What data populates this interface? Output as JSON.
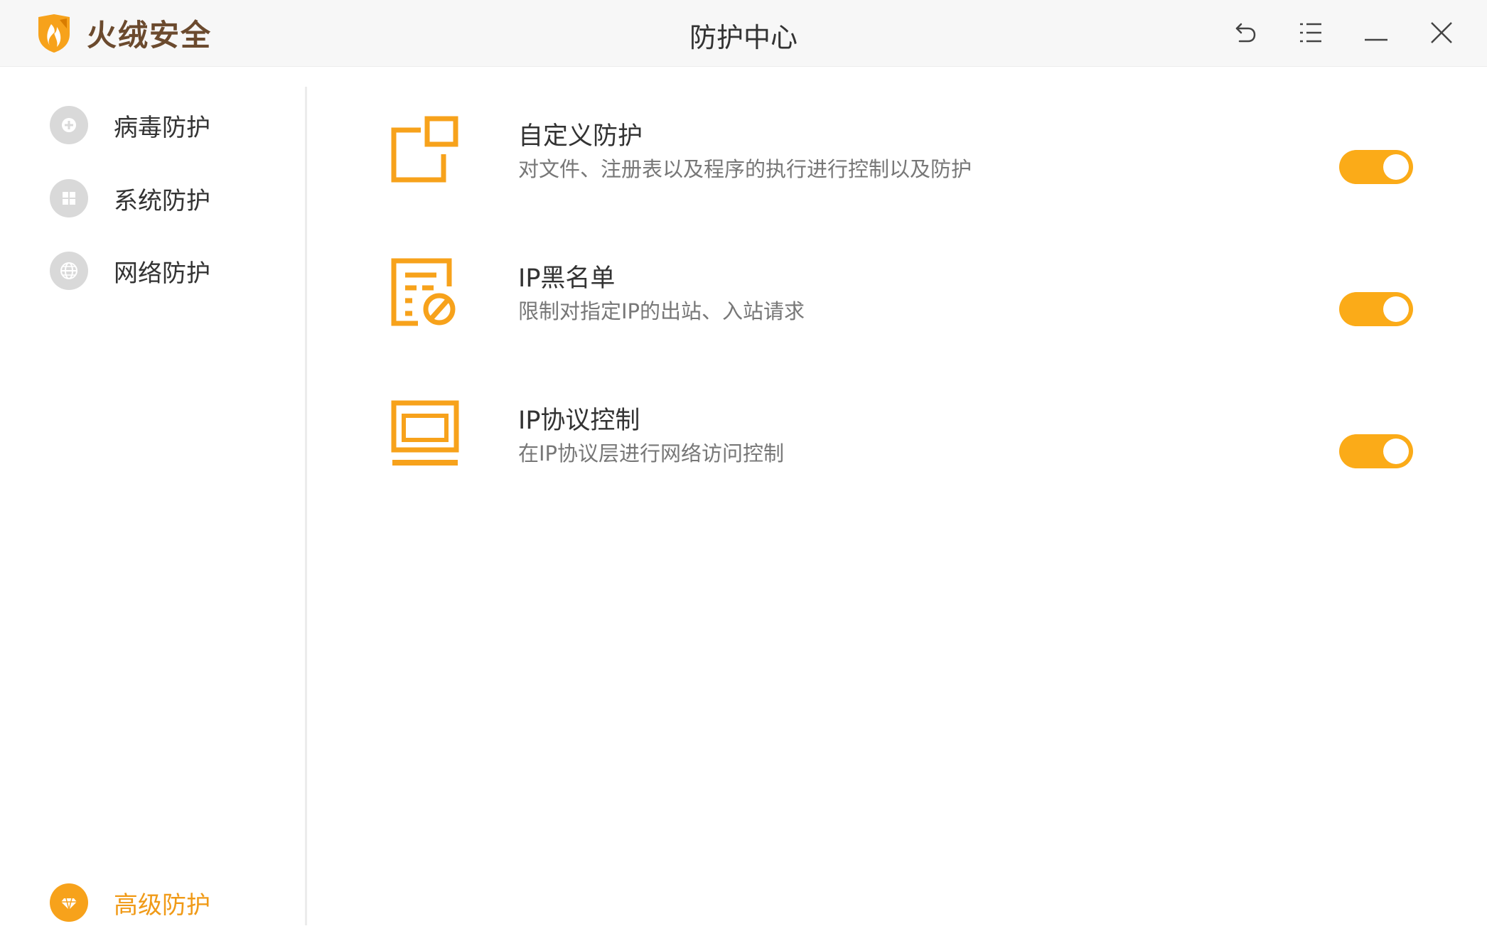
{
  "app": {
    "brand_name": "火绒安全",
    "window_title": "防护中心",
    "accent_color": "#f7a21b",
    "brand_text_color": "#6b4a2e",
    "controls": [
      {
        "name": "back",
        "icon": "undo-arrow-icon"
      },
      {
        "name": "menu",
        "icon": "menu-list-icon"
      },
      {
        "name": "minimize",
        "icon": "minimize-icon"
      },
      {
        "name": "close",
        "icon": "close-icon"
      }
    ]
  },
  "sidebar": {
    "items": [
      {
        "label": "病毒防护",
        "icon": "virus-shield-icon",
        "active": false
      },
      {
        "label": "系统防护",
        "icon": "windows-icon",
        "active": false
      },
      {
        "label": "网络防护",
        "icon": "globe-icon",
        "active": false
      }
    ],
    "bottom_item": {
      "label": "高级防护",
      "icon": "diamond-icon",
      "active": true
    }
  },
  "features": [
    {
      "title": "自定义防护",
      "description": "对文件、注册表以及程序的执行进行控制以及防护",
      "icon": "custom-window-icon",
      "enabled": true
    },
    {
      "title": "IP黑名单",
      "description": "限制对指定IP的出站、入站请求",
      "icon": "blacklist-document-icon",
      "enabled": true
    },
    {
      "title": "IP协议控制",
      "description": "在IP协议层进行网络访问控制",
      "icon": "laptop-icon",
      "enabled": true
    }
  ]
}
